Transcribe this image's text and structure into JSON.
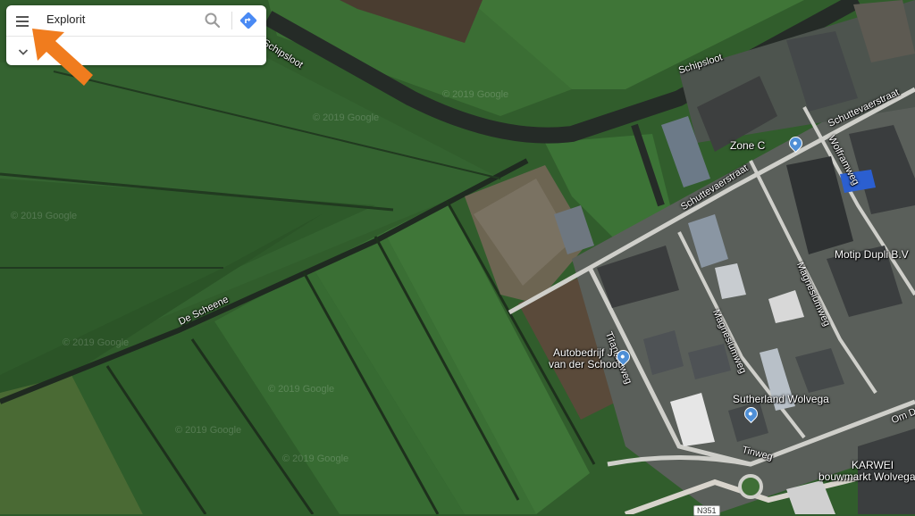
{
  "search": {
    "query": "Explorit"
  },
  "map": {
    "labels": {
      "schipsloot_1": "Schipsloot",
      "schipsloot_2": "Schipsloot",
      "de_scheene": "De Scheene",
      "schuttevaerstraat_1": "Schuttevaerstraat",
      "schuttevaerstraat_2": "Schuttevaerstraat",
      "wolframweg": "Wolframweg",
      "magnesiumweg_1": "Magnesiumweg",
      "magnesiumweg_2": "Magnesiumweg",
      "titaniumweg": "Titaniumweg",
      "tinweg": "Tinweg",
      "om_de": "Om De",
      "road_shield": "N351"
    },
    "places": {
      "zone_c": "Zone C",
      "motip": "Motip Dupli B.V",
      "autobedrijf_line1": "Autobedrijf J.",
      "autobedrijf_line2": "van der Schoot",
      "sutherland": "Sutherland Wolvega",
      "karwei_line1": "KARWEI",
      "karwei_line2": "bouwmarkt Wolvega"
    },
    "watermarks": [
      "© 2019 Google",
      "© 2019 Google",
      "© 2019 Google",
      "© 2019 Google",
      "© 2019 Google",
      "© 2019 Google",
      "© 2019 Google"
    ]
  },
  "colors": {
    "field_dark": "#2c5628",
    "field_light": "#3d7335",
    "canal": "#2a2f2b",
    "road": "#c9c9c4",
    "pin_blue": "#4f8fd6",
    "arrow_orange": "#f07c1e",
    "direction_blue": "#4a8af4"
  }
}
